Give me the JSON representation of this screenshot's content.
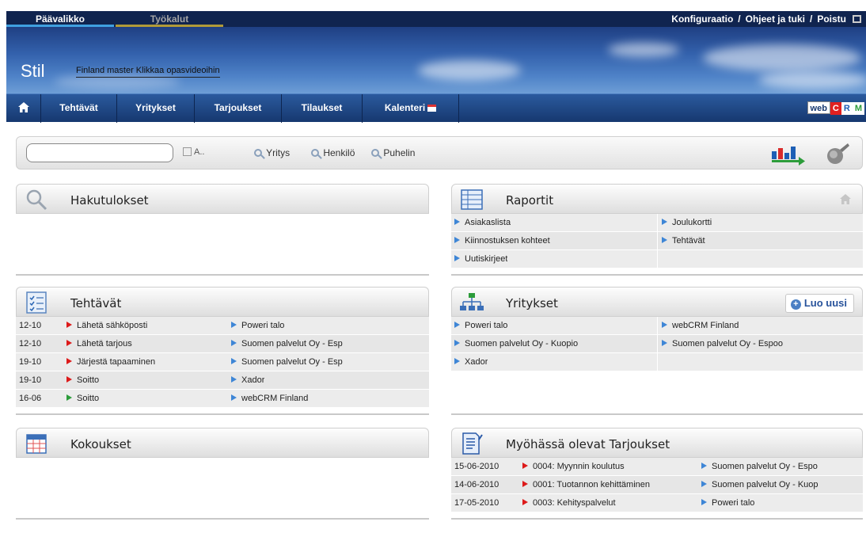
{
  "topbar": {
    "main_menu": "Päävalikko",
    "tools_menu": "Työkalut",
    "links": [
      "Konfiguraatio",
      "Ohjeet ja tuki",
      "Poistu"
    ],
    "separator": "/"
  },
  "banner": {
    "brand": "Stil",
    "subtitle": "Finland master Klikkaa opasvideoihin"
  },
  "nav": {
    "items": [
      "Tehtävät",
      "Yritykset",
      "Tarjoukset",
      "Tilaukset",
      "Kalenteri"
    ],
    "logo": [
      "web",
      "C",
      "R",
      "M"
    ]
  },
  "search": {
    "input_value": "",
    "checkbox_label": "A..",
    "options": [
      "Yritys",
      "Henkilö",
      "Puhelin"
    ]
  },
  "panels": {
    "search_results": {
      "title": "Hakutulokset"
    },
    "reports": {
      "title": "Raportit",
      "rows": [
        [
          "Asiakaslista",
          "Joulukortti"
        ],
        [
          "Kiinnostuksen kohteet",
          "Tehtävät"
        ],
        [
          "Uutiskirjeet",
          ""
        ]
      ]
    },
    "tasks": {
      "title": "Tehtävät",
      "rows": [
        {
          "date": "12-10",
          "task": "Lähetä sähköposti",
          "company": "Poweri talo",
          "status": "red"
        },
        {
          "date": "12-10",
          "task": "Lähetä tarjous",
          "company": "Suomen palvelut Oy - Esp",
          "status": "red"
        },
        {
          "date": "19-10",
          "task": "Järjestä tapaaminen",
          "company": "Suomen palvelut Oy - Esp",
          "status": "red"
        },
        {
          "date": "19-10",
          "task": "Soitto",
          "company": "Xador",
          "status": "red"
        },
        {
          "date": "16-06",
          "task": "Soitto",
          "company": "webCRM Finland",
          "status": "green"
        }
      ]
    },
    "companies": {
      "title": "Yritykset",
      "new_button": "Luo uusi",
      "rows": [
        [
          "Poweri talo",
          "webCRM Finland"
        ],
        [
          "Suomen palvelut Oy - Kuopio",
          "Suomen palvelut Oy - Espoo"
        ],
        [
          "Xador",
          ""
        ]
      ]
    },
    "meetings": {
      "title": "Kokoukset"
    },
    "late_offers": {
      "title": "Myöhässä olevat Tarjoukset",
      "rows": [
        {
          "date": "15-06-2010",
          "offer": "0004: Myynnin koulutus",
          "company": "Suomen palvelut Oy - Espo"
        },
        {
          "date": "14-06-2010",
          "offer": "0001: Tuotannon kehittäminen",
          "company": "Suomen palvelut Oy - Kuop"
        },
        {
          "date": "17-05-2010",
          "offer": "0003: Kehityspalvelut",
          "company": "Poweri talo"
        }
      ]
    }
  },
  "colors": {
    "navy": "#10244f",
    "nav_blue": "#16386f",
    "arrow_blue": "#3e86d6",
    "arrow_red": "#dd1a1a",
    "arrow_green": "#2c9c3a"
  }
}
